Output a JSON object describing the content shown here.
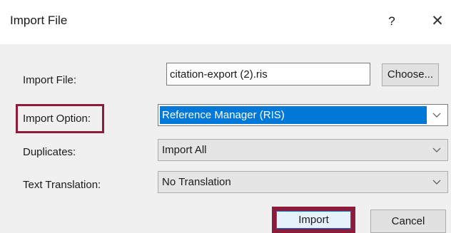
{
  "window": {
    "title": "Import File",
    "help_label": "?",
    "close_label": "✕"
  },
  "form": {
    "import_file": {
      "label": "Import File:",
      "value": "citation-export (2).ris",
      "choose_label": "Choose..."
    },
    "import_option": {
      "label": "Import Option:",
      "selected": "Reference Manager (RIS)"
    },
    "duplicates": {
      "label": "Duplicates:",
      "selected": "Import All"
    },
    "text_translation": {
      "label": "Text Translation:",
      "selected": "No Translation"
    }
  },
  "buttons": {
    "import_label": "Import",
    "cancel_label": "Cancel"
  },
  "colors": {
    "highlight": "#8c1c3a",
    "selection": "#0078d7"
  }
}
